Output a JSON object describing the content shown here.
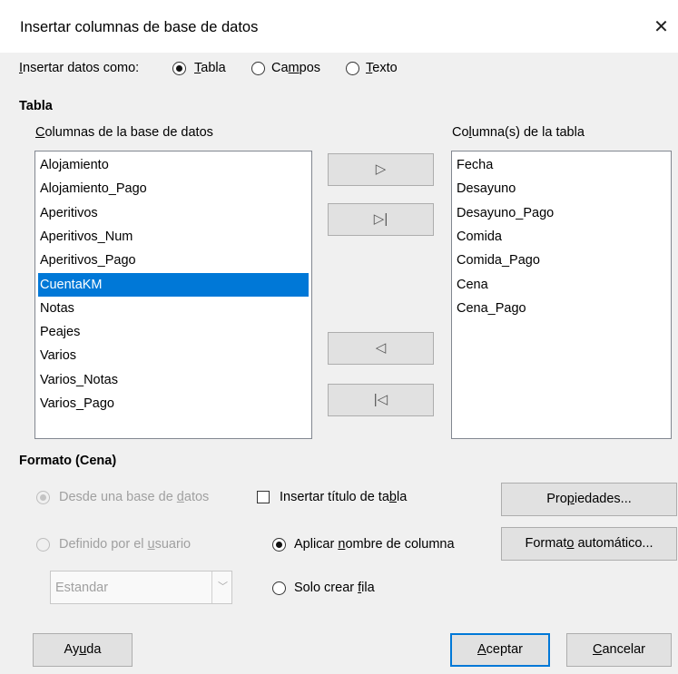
{
  "window": {
    "title": "Insertar columnas de base de datos",
    "close_glyph": "✕"
  },
  "insert_as": {
    "label": "Insertar datos como:",
    "options": [
      {
        "label": "Tabla",
        "checked": true
      },
      {
        "label": "Campos",
        "checked": false
      },
      {
        "label": "Texto",
        "checked": false
      }
    ]
  },
  "table_section": {
    "title": "Tabla",
    "db_columns_label": "Columnas de la base de datos",
    "db_columns": [
      "Alojamiento",
      "Alojamiento_Pago",
      "Aperitivos",
      "Aperitivos_Num",
      "Aperitivos_Pago",
      "CuentaKM",
      "Notas",
      "Peajes",
      "Varios",
      "Varios_Notas",
      "Varios_Pago"
    ],
    "selected_index": 5,
    "table_columns_label": "Columna(s) de la tabla",
    "table_columns": [
      "Fecha",
      "Desayuno",
      "Desayuno_Pago",
      "Comida",
      "Comida_Pago",
      "Cena",
      "Cena_Pago"
    ],
    "move_buttons": {
      "add_one": "▷",
      "add_all": "▷|",
      "remove_one": "◁",
      "remove_all": "|◁"
    }
  },
  "format_section": {
    "title": "Formato (Cena)",
    "from_db_label": "Desde una base de datos",
    "user_defined_label": "Definido por el usuario",
    "format_combo_value": "Estandar",
    "insert_title_label": "Insertar título de tabla",
    "insert_title_checked": false,
    "apply_col_name_label": "Aplicar nombre de columna",
    "only_row_label": "Solo crear fila",
    "properties_button": "Propiedades...",
    "autoformat_button": "Formato automático..."
  },
  "footer": {
    "help": "Ayuda",
    "ok": "Aceptar",
    "cancel": "Cancelar"
  }
}
